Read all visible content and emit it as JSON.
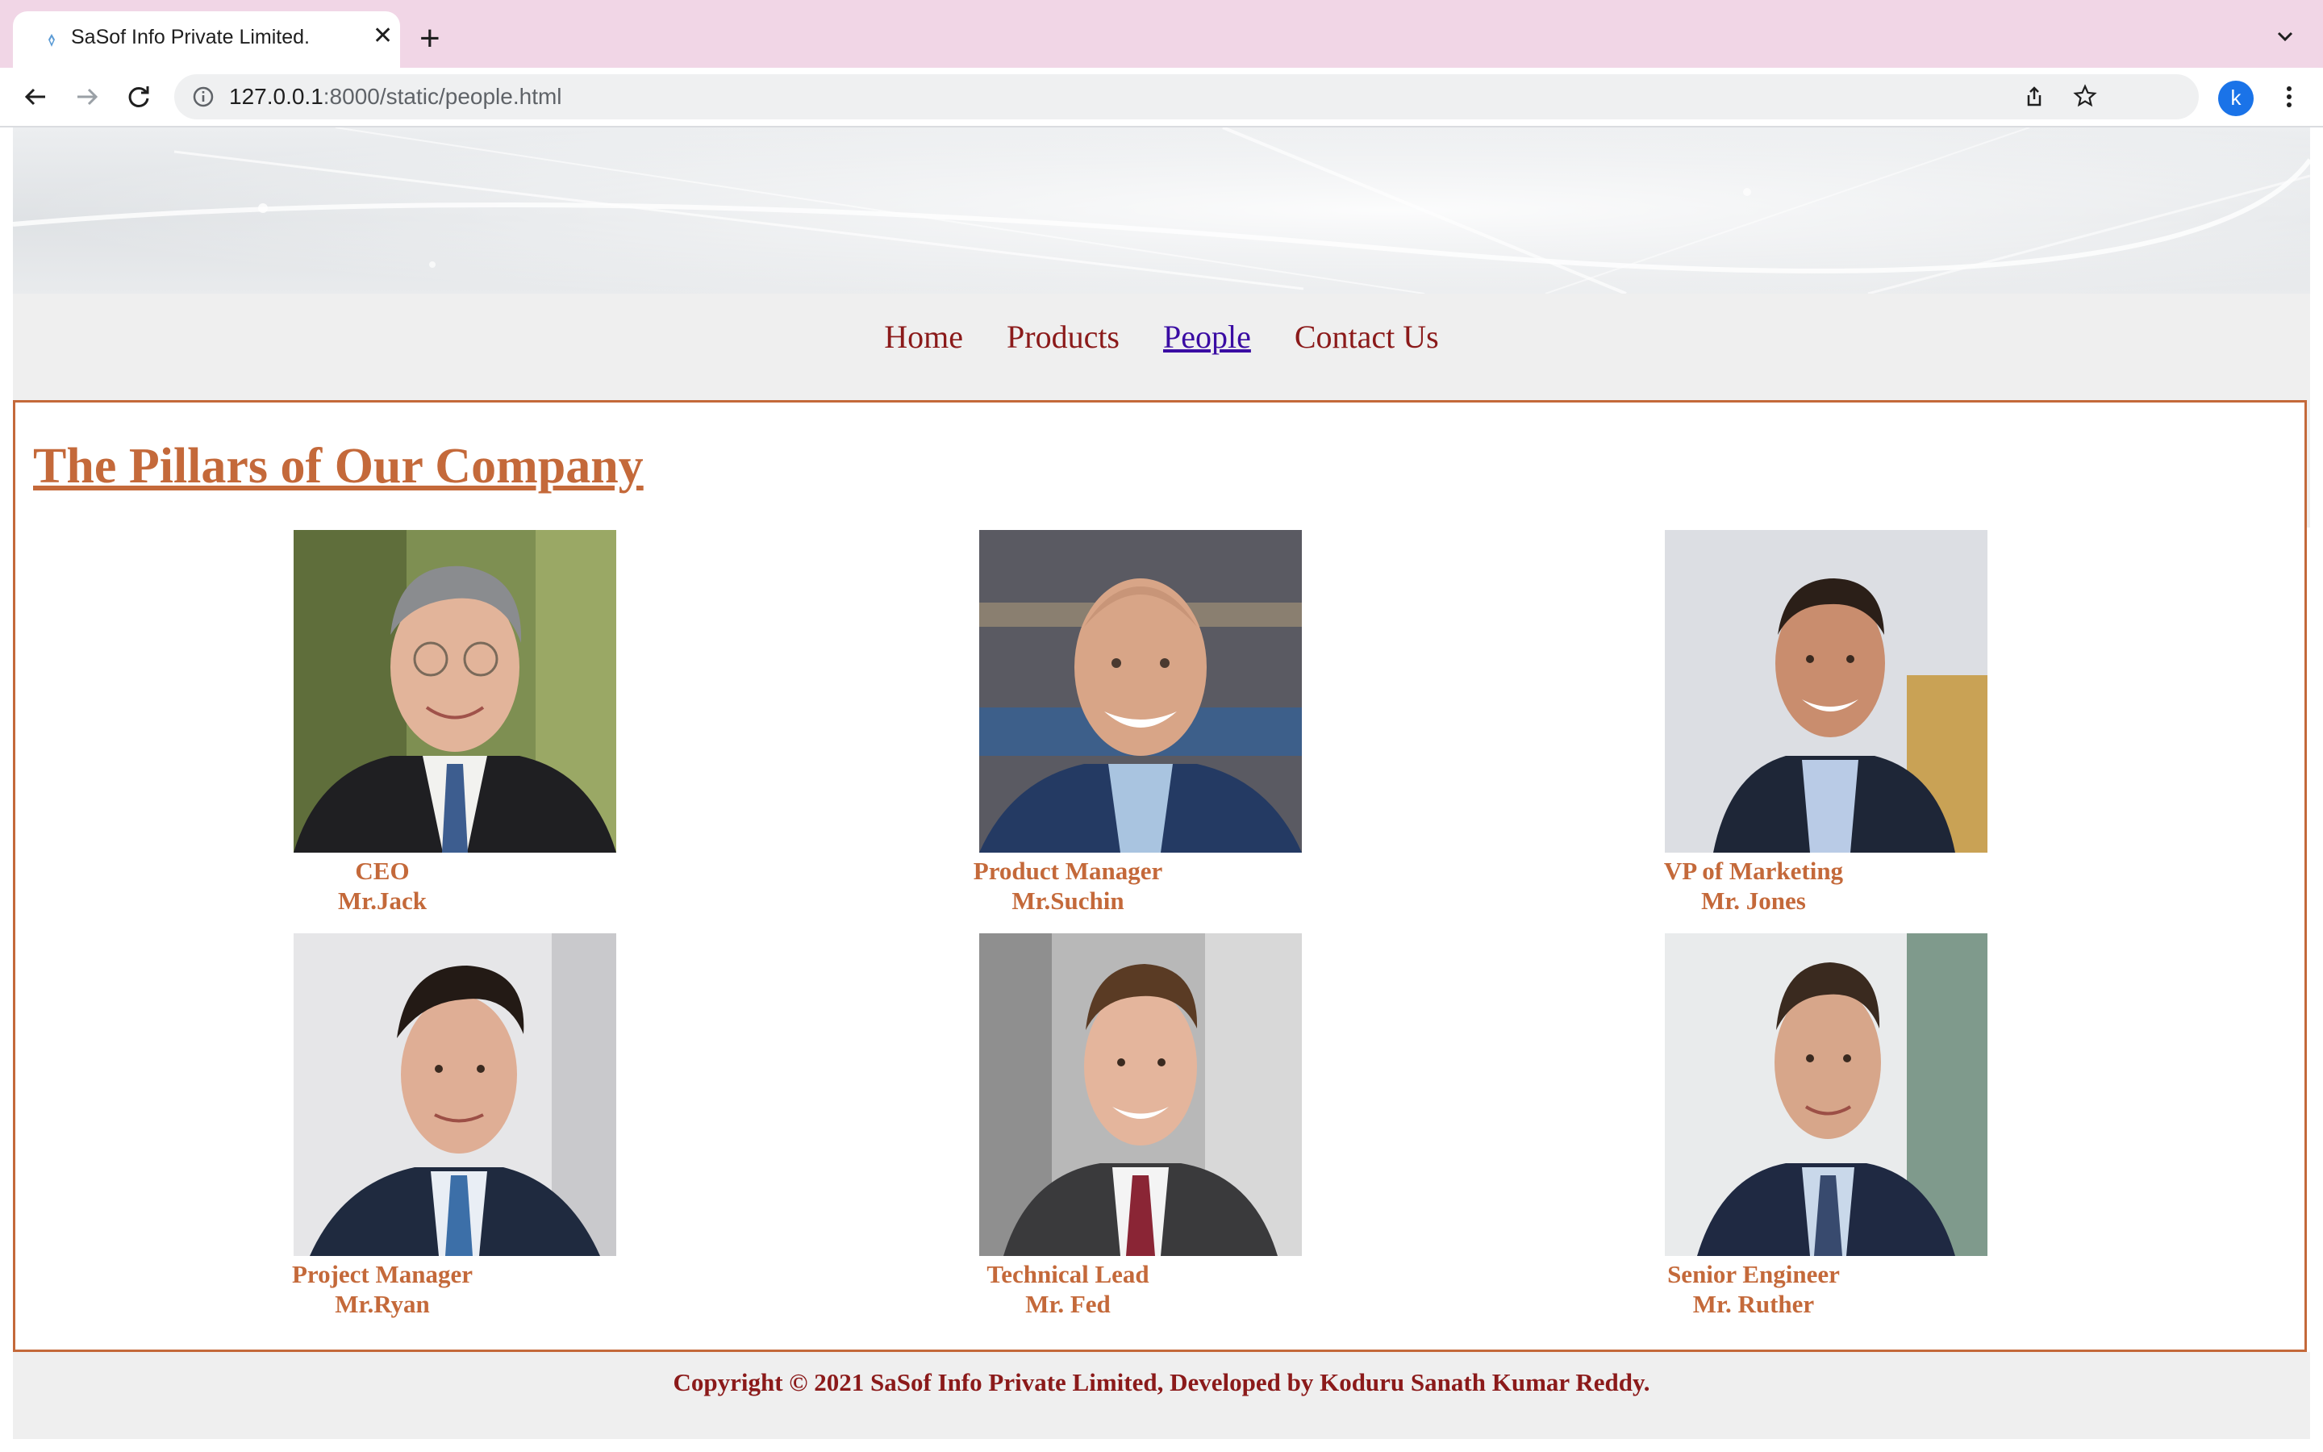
{
  "browser": {
    "tab_title": "SaSof Info Private Limited.",
    "url_host": "127.0.0.1",
    "url_rest": ":8000/static/people.html",
    "profile_initial": "k"
  },
  "nav": {
    "items": [
      {
        "label": "Home"
      },
      {
        "label": "Products"
      },
      {
        "label": "People"
      },
      {
        "label": "Contact Us"
      }
    ],
    "active": "People"
  },
  "main": {
    "heading": "The Pillars of Our Company",
    "people": [
      {
        "role": "CEO",
        "name": "Mr.Jack"
      },
      {
        "role": "Product Manager",
        "name": "Mr.Suchin"
      },
      {
        "role": "VP of Marketing",
        "name": "Mr. Jones"
      },
      {
        "role": "Project Manager",
        "name": "Mr.Ryan"
      },
      {
        "role": "Technical Lead",
        "name": "Mr. Fed"
      },
      {
        "role": "Senior Engineer",
        "name": "Mr. Ruther"
      }
    ]
  },
  "footer": {
    "copyright": "Copyright © 2021 SaSof Info Private Limited, Developed by Koduru Sanath Kumar Reddy."
  },
  "colors": {
    "heading": "#c4693a",
    "nav_link": "#8b1a1a",
    "nav_active": "#3a0ca3",
    "tabstrip": "#f1d6e6"
  }
}
